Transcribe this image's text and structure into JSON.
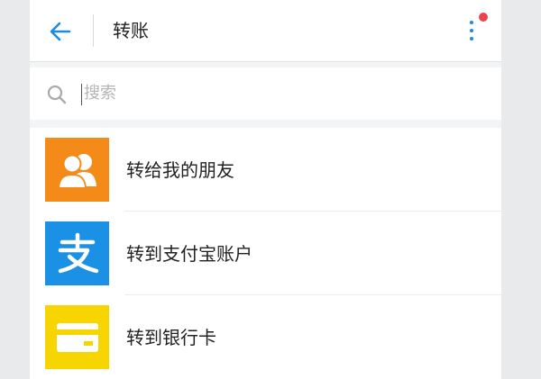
{
  "header": {
    "title": "转账"
  },
  "search": {
    "placeholder": "搜索"
  },
  "menu": {
    "items": [
      {
        "label": "转给我的朋友",
        "icon": "friends-icon",
        "color": "#f48a17"
      },
      {
        "label": "转到支付宝账户",
        "icon": "alipay-icon",
        "color": "#1a91e5"
      },
      {
        "label": "转到银行卡",
        "icon": "bank-card-icon",
        "color": "#f7d500"
      }
    ]
  },
  "colors": {
    "accent": "#1d8ce0",
    "notification": "#e8464a"
  }
}
